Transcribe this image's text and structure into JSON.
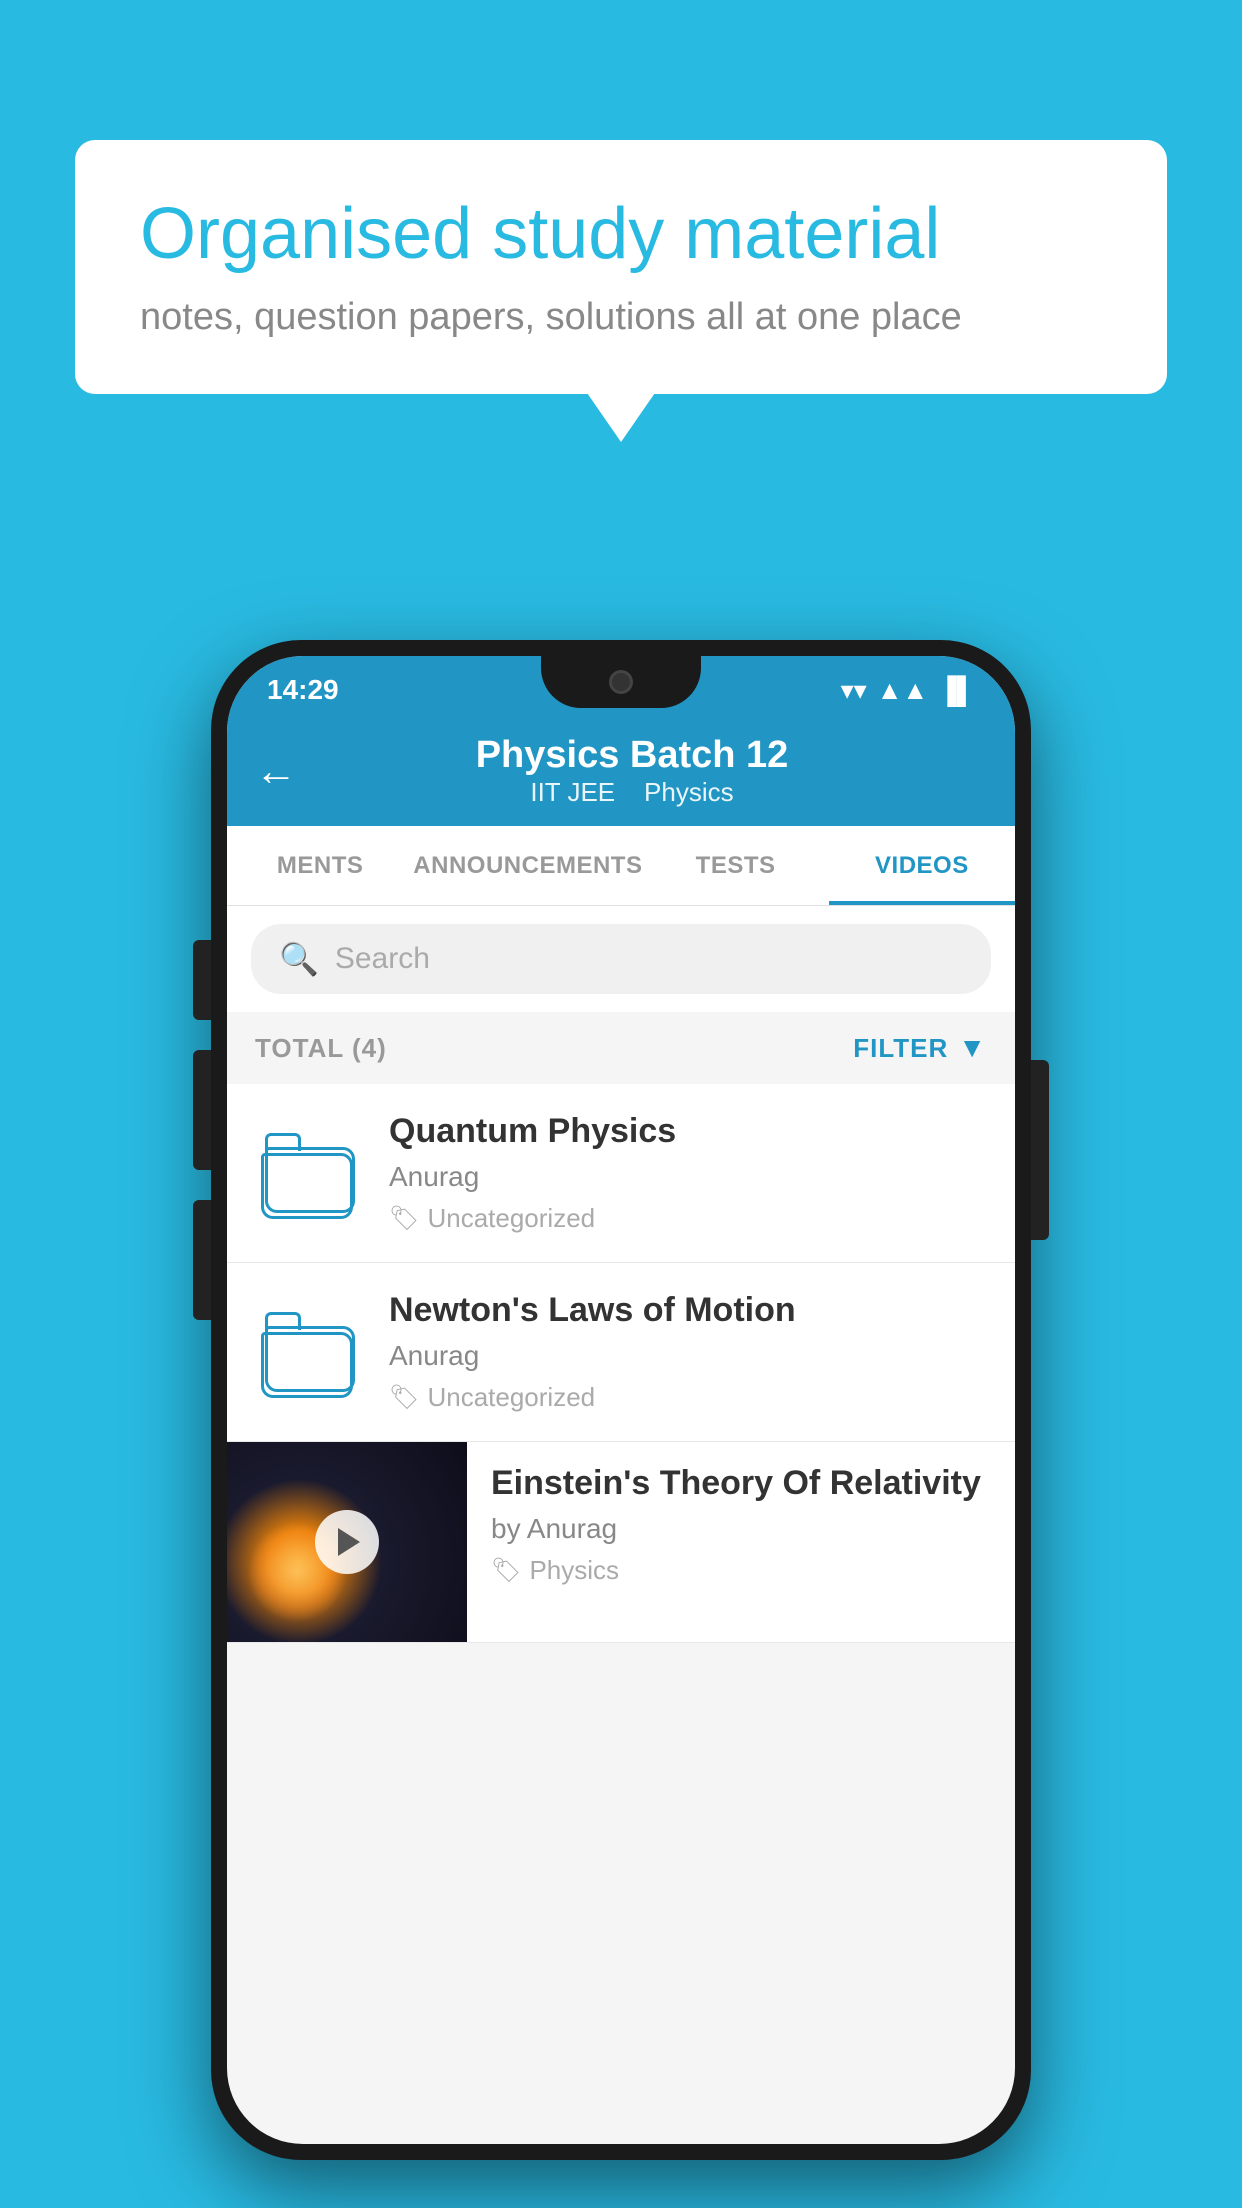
{
  "page": {
    "background_color": "#29BAE2"
  },
  "speech_bubble": {
    "title": "Organised study material",
    "subtitle": "notes, question papers, solutions all at one place"
  },
  "status_bar": {
    "time": "14:29",
    "wifi_icon": "▼",
    "signal_icon": "▲",
    "battery_icon": "▐"
  },
  "toolbar": {
    "back_icon": "←",
    "title": "Physics Batch 12",
    "subtitle_tag1": "IIT JEE",
    "subtitle_separator": "  ",
    "subtitle_tag2": "Physics"
  },
  "tabs": [
    {
      "id": "ments",
      "label": "MENTS",
      "active": false
    },
    {
      "id": "announcements",
      "label": "ANNOUNCEMENTS",
      "active": false
    },
    {
      "id": "tests",
      "label": "TESTS",
      "active": false
    },
    {
      "id": "videos",
      "label": "VIDEOS",
      "active": true
    }
  ],
  "search": {
    "placeholder": "Search",
    "icon": "🔍"
  },
  "filter_row": {
    "total_label": "TOTAL (4)",
    "filter_label": "FILTER",
    "filter_icon": "▼"
  },
  "videos": [
    {
      "id": "quantum",
      "title": "Quantum Physics",
      "author": "Anurag",
      "tag": "Uncategorized",
      "has_thumbnail": false
    },
    {
      "id": "newton",
      "title": "Newton's Laws of Motion",
      "author": "Anurag",
      "tag": "Uncategorized",
      "has_thumbnail": false
    },
    {
      "id": "einstein",
      "title": "Einstein's Theory Of Relativity",
      "author": "by Anurag",
      "tag": "Physics",
      "has_thumbnail": true
    }
  ]
}
